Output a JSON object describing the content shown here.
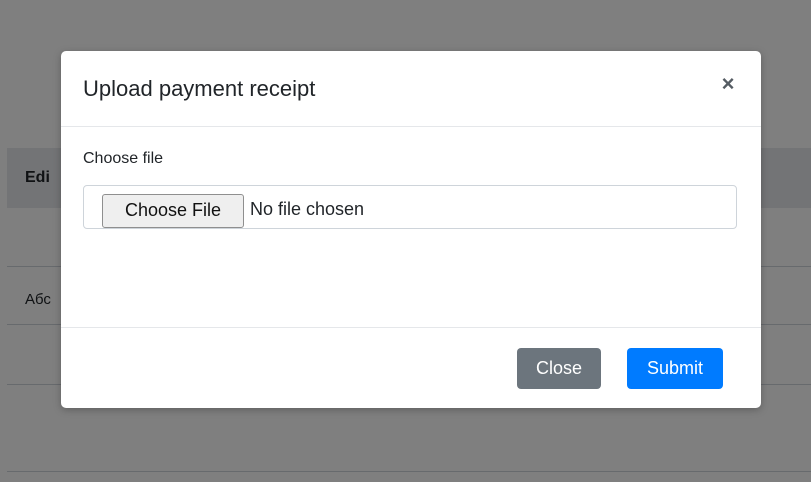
{
  "background": {
    "table_header_cell": "Edi",
    "row_cell": "Абс"
  },
  "modal": {
    "title": "Upload payment receipt",
    "close_icon": "×",
    "body": {
      "label": "Choose file",
      "file_button_label": "Choose File",
      "file_status": "No file chosen"
    },
    "footer": {
      "close_label": "Close",
      "submit_label": "Submit"
    }
  },
  "colors": {
    "submit": "#007bff",
    "close": "#6c757d"
  }
}
